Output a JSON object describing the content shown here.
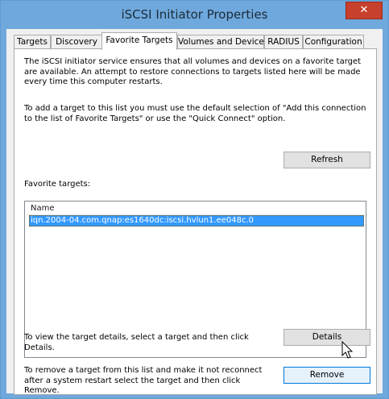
{
  "window": {
    "title": "iSCSI Initiator Properties",
    "close_glyph": "✕"
  },
  "tabs": [
    {
      "label": "Targets"
    },
    {
      "label": "Discovery"
    },
    {
      "label": "Favorite Targets",
      "active": true
    },
    {
      "label": "Volumes and Devices"
    },
    {
      "label": "RADIUS"
    },
    {
      "label": "Configuration"
    }
  ],
  "panel": {
    "intro_text": "The iSCSI initiator service ensures that all volumes and devices on a favorite target are available.  An attempt to restore connections to targets listed here will be made every time this computer restarts.",
    "add_text": "To add a target to this list you must use the default selection of \"Add this connection to the list of Favorite Targets\" or use the \"Quick Connect\" option.",
    "favorite_label": "Favorite targets:",
    "refresh_label": "Refresh",
    "list": {
      "header": "Name",
      "items": [
        "iqn.2004-04.com.qnap:es1640dc:iscsi.hvlun1.ee048c.0"
      ]
    },
    "details_text": "To view the target details, select a target and then click Details.",
    "details_label": "Details",
    "remove_text": "To remove a target from this list and make it not reconnect after a system restart select the target and then click Remove.",
    "remove_label": "Remove"
  },
  "icons": {
    "close": "close-icon",
    "cursor": "mouse-pointer-icon"
  },
  "colors": {
    "titlebar": "#6fa8dc",
    "close_button": "#c7402d",
    "selection": "#3399ff",
    "button_hover": "#e5f1fb"
  }
}
